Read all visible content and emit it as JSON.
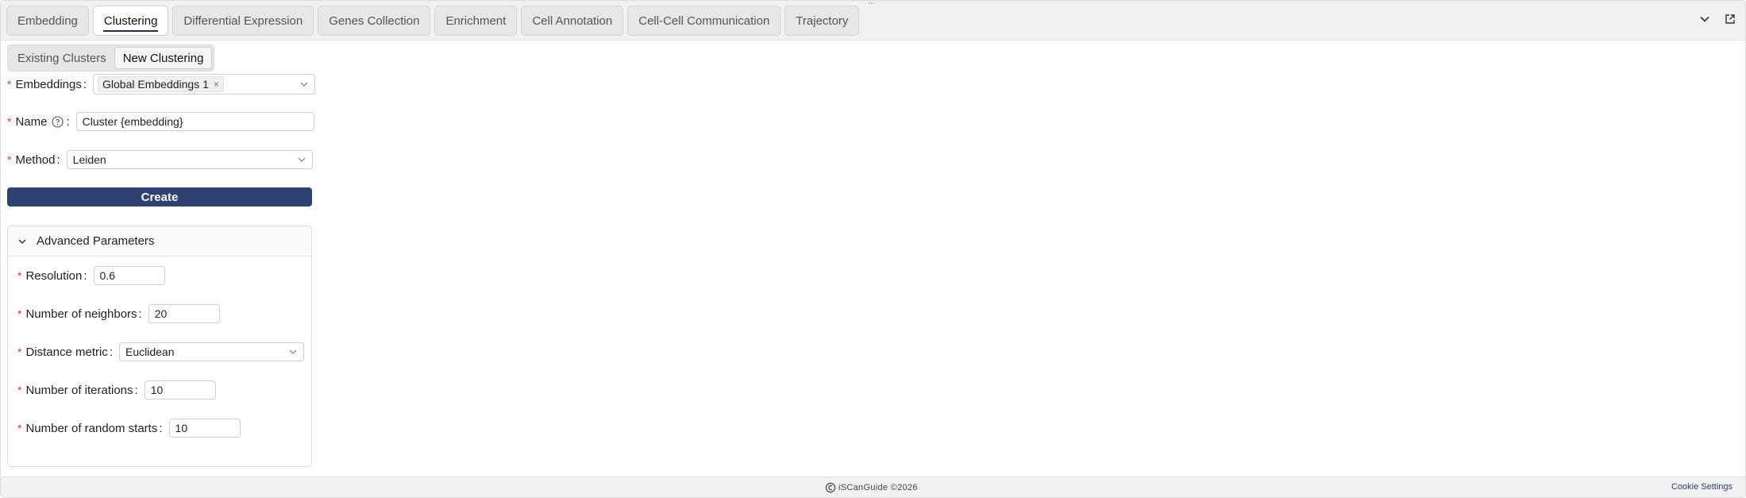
{
  "tabs": [
    {
      "label": "Embedding"
    },
    {
      "label": "Clustering"
    },
    {
      "label": "Differential Expression"
    },
    {
      "label": "Genes Collection"
    },
    {
      "label": "Enrichment"
    },
    {
      "label": "Cell Annotation"
    },
    {
      "label": "Cell-Cell Communication"
    },
    {
      "label": "Trajectory"
    }
  ],
  "subtabs": [
    {
      "label": "Existing Clusters"
    },
    {
      "label": "New Clustering"
    }
  ],
  "form": {
    "embeddings": {
      "label": "Embeddings",
      "value": "Global Embeddings 1",
      "remove_glyph": "×"
    },
    "name": {
      "label": "Name",
      "value": "Cluster {embedding}"
    },
    "method": {
      "label": "Method",
      "value": "Leiden"
    },
    "create_label": "Create"
  },
  "advanced": {
    "title": "Advanced Parameters",
    "resolution": {
      "label": "Resolution",
      "value": "0.6"
    },
    "neighbors": {
      "label": "Number of neighbors",
      "value": "20"
    },
    "distance": {
      "label": "Distance metric",
      "value": "Euclidean"
    },
    "iterations": {
      "label": "Number of iterations",
      "value": "10"
    },
    "random_starts": {
      "label": "Number of random starts",
      "value": "10"
    }
  },
  "footer": {
    "brand": "iSCanGuide ©2026",
    "cookie": "Cookie Settings"
  },
  "colors": {
    "primary": "#2d4270",
    "required": "#e0413a"
  }
}
